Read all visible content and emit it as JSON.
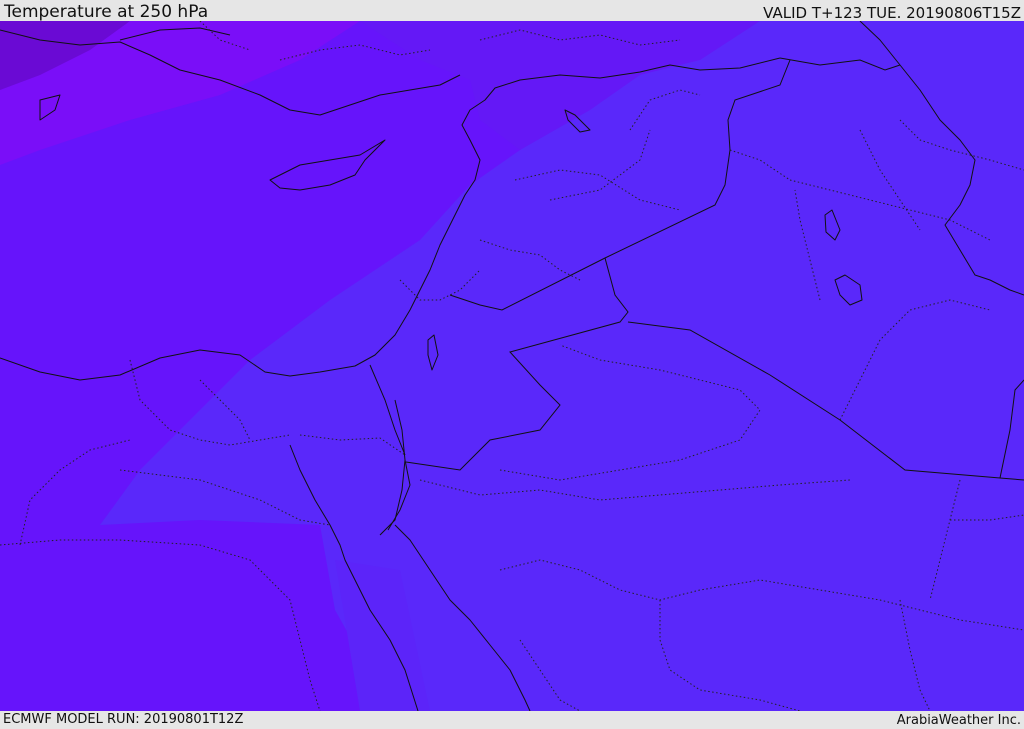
{
  "header": {
    "title": "Temperature at 250 hPa",
    "valid": "VALID T+123 TUE. 20190806T15Z"
  },
  "footer": {
    "model_run": "ECMWF MODEL RUN: 20190801T12Z",
    "credit": "ArabiaWeather Inc."
  },
  "map": {
    "variable": "temperature",
    "level": "250 hPa",
    "colors": {
      "deep_violet": "#7a1ee8",
      "violet": "#6e14f8",
      "blue_violet": "#6614fb",
      "indigo": "#5a28fa",
      "darkest": "#6a0ad4"
    }
  }
}
